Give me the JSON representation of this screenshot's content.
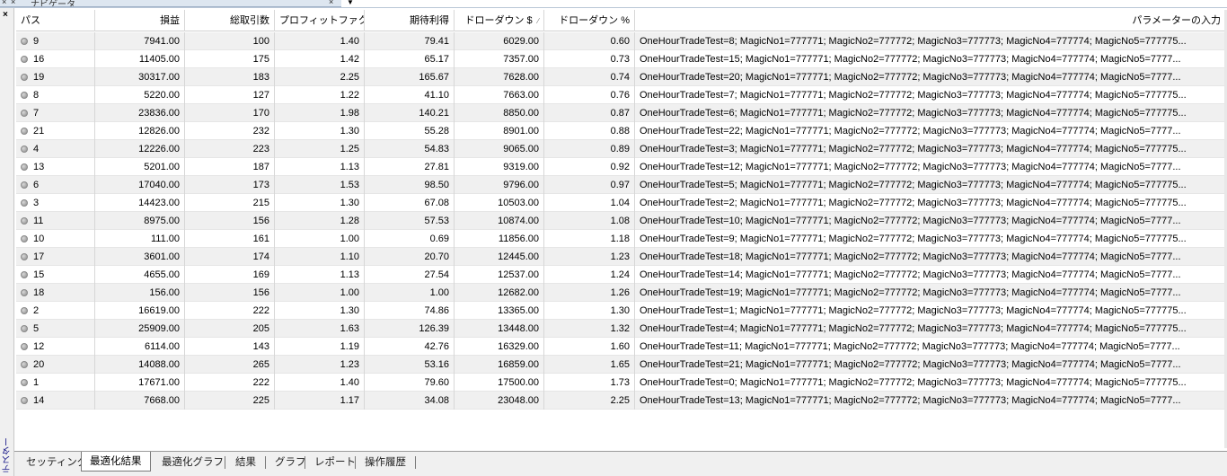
{
  "top_panel": {
    "title": "ナビゲータ"
  },
  "side_strip": {
    "label": "テスター"
  },
  "grid": {
    "columns": [
      "パス",
      "損益",
      "総取引数",
      "プロフィットファクタ",
      "期待利得",
      "ドローダウン $",
      "ドローダウン %",
      "パラメーターの入力"
    ],
    "rows": [
      [
        "9",
        "7941.00",
        "100",
        "1.40",
        "79.41",
        "6029.00",
        "0.60",
        "OneHourTradeTest=8; MagicNo1=777771; MagicNo2=777772; MagicNo3=777773; MagicNo4=777774; MagicNo5=777775..."
      ],
      [
        "16",
        "11405.00",
        "175",
        "1.42",
        "65.17",
        "7357.00",
        "0.73",
        "OneHourTradeTest=15; MagicNo1=777771; MagicNo2=777772; MagicNo3=777773; MagicNo4=777774; MagicNo5=7777..."
      ],
      [
        "19",
        "30317.00",
        "183",
        "2.25",
        "165.67",
        "7628.00",
        "0.74",
        "OneHourTradeTest=20; MagicNo1=777771; MagicNo2=777772; MagicNo3=777773; MagicNo4=777774; MagicNo5=7777..."
      ],
      [
        "8",
        "5220.00",
        "127",
        "1.22",
        "41.10",
        "7663.00",
        "0.76",
        "OneHourTradeTest=7; MagicNo1=777771; MagicNo2=777772; MagicNo3=777773; MagicNo4=777774; MagicNo5=777775..."
      ],
      [
        "7",
        "23836.00",
        "170",
        "1.98",
        "140.21",
        "8850.00",
        "0.87",
        "OneHourTradeTest=6; MagicNo1=777771; MagicNo2=777772; MagicNo3=777773; MagicNo4=777774; MagicNo5=777775..."
      ],
      [
        "21",
        "12826.00",
        "232",
        "1.30",
        "55.28",
        "8901.00",
        "0.88",
        "OneHourTradeTest=22; MagicNo1=777771; MagicNo2=777772; MagicNo3=777773; MagicNo4=777774; MagicNo5=7777..."
      ],
      [
        "4",
        "12226.00",
        "223",
        "1.25",
        "54.83",
        "9065.00",
        "0.89",
        "OneHourTradeTest=3; MagicNo1=777771; MagicNo2=777772; MagicNo3=777773; MagicNo4=777774; MagicNo5=777775..."
      ],
      [
        "13",
        "5201.00",
        "187",
        "1.13",
        "27.81",
        "9319.00",
        "0.92",
        "OneHourTradeTest=12; MagicNo1=777771; MagicNo2=777772; MagicNo3=777773; MagicNo4=777774; MagicNo5=7777..."
      ],
      [
        "6",
        "17040.00",
        "173",
        "1.53",
        "98.50",
        "9796.00",
        "0.97",
        "OneHourTradeTest=5; MagicNo1=777771; MagicNo2=777772; MagicNo3=777773; MagicNo4=777774; MagicNo5=777775..."
      ],
      [
        "3",
        "14423.00",
        "215",
        "1.30",
        "67.08",
        "10503.00",
        "1.04",
        "OneHourTradeTest=2; MagicNo1=777771; MagicNo2=777772; MagicNo3=777773; MagicNo4=777774; MagicNo5=777775..."
      ],
      [
        "11",
        "8975.00",
        "156",
        "1.28",
        "57.53",
        "10874.00",
        "1.08",
        "OneHourTradeTest=10; MagicNo1=777771; MagicNo2=777772; MagicNo3=777773; MagicNo4=777774; MagicNo5=7777..."
      ],
      [
        "10",
        "111.00",
        "161",
        "1.00",
        "0.69",
        "11856.00",
        "1.18",
        "OneHourTradeTest=9; MagicNo1=777771; MagicNo2=777772; MagicNo3=777773; MagicNo4=777774; MagicNo5=777775..."
      ],
      [
        "17",
        "3601.00",
        "174",
        "1.10",
        "20.70",
        "12445.00",
        "1.23",
        "OneHourTradeTest=18; MagicNo1=777771; MagicNo2=777772; MagicNo3=777773; MagicNo4=777774; MagicNo5=7777..."
      ],
      [
        "15",
        "4655.00",
        "169",
        "1.13",
        "27.54",
        "12537.00",
        "1.24",
        "OneHourTradeTest=14; MagicNo1=777771; MagicNo2=777772; MagicNo3=777773; MagicNo4=777774; MagicNo5=7777..."
      ],
      [
        "18",
        "156.00",
        "156",
        "1.00",
        "1.00",
        "12682.00",
        "1.26",
        "OneHourTradeTest=19; MagicNo1=777771; MagicNo2=777772; MagicNo3=777773; MagicNo4=777774; MagicNo5=7777..."
      ],
      [
        "2",
        "16619.00",
        "222",
        "1.30",
        "74.86",
        "13365.00",
        "1.30",
        "OneHourTradeTest=1; MagicNo1=777771; MagicNo2=777772; MagicNo3=777773; MagicNo4=777774; MagicNo5=777775..."
      ],
      [
        "5",
        "25909.00",
        "205",
        "1.63",
        "126.39",
        "13448.00",
        "1.32",
        "OneHourTradeTest=4; MagicNo1=777771; MagicNo2=777772; MagicNo3=777773; MagicNo4=777774; MagicNo5=777775..."
      ],
      [
        "12",
        "6114.00",
        "143",
        "1.19",
        "42.76",
        "16329.00",
        "1.60",
        "OneHourTradeTest=11; MagicNo1=777771; MagicNo2=777772; MagicNo3=777773; MagicNo4=777774; MagicNo5=7777..."
      ],
      [
        "20",
        "14088.00",
        "265",
        "1.23",
        "53.16",
        "16859.00",
        "1.65",
        "OneHourTradeTest=21; MagicNo1=777771; MagicNo2=777772; MagicNo3=777773; MagicNo4=777774; MagicNo5=7777..."
      ],
      [
        "1",
        "17671.00",
        "222",
        "1.40",
        "79.60",
        "17500.00",
        "1.73",
        "OneHourTradeTest=0; MagicNo1=777771; MagicNo2=777772; MagicNo3=777773; MagicNo4=777774; MagicNo5=777775..."
      ],
      [
        "14",
        "7668.00",
        "225",
        "1.17",
        "34.08",
        "23048.00",
        "2.25",
        "OneHourTradeTest=13; MagicNo1=777771; MagicNo2=777772; MagicNo3=777773; MagicNo4=777774; MagicNo5=7777..."
      ]
    ]
  },
  "tabs": [
    {
      "label": "セッティング",
      "active": false
    },
    {
      "label": "最適化結果",
      "active": true
    },
    {
      "label": "最適化グラフ",
      "active": false
    },
    {
      "label": "結果",
      "active": false
    },
    {
      "label": "グラフ",
      "active": false
    },
    {
      "label": "レポート",
      "active": false
    },
    {
      "label": "操作履歴",
      "active": false
    }
  ],
  "icons": {
    "row_icon": "pass-dot-icon",
    "sort_icon": "sort-indicator-icon",
    "close_icon": "close-icon"
  }
}
